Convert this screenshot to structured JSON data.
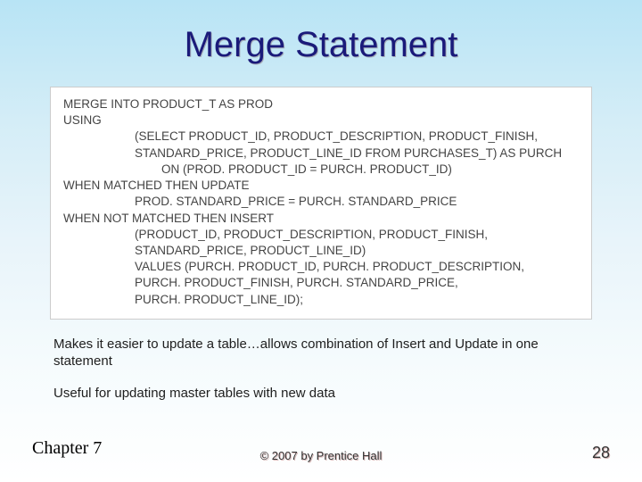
{
  "title": "Merge Statement",
  "code": {
    "line1": "MERGE INTO PRODUCT_T AS PROD",
    "line2": "USING",
    "line3": "(SELECT PRODUCT_ID, PRODUCT_DESCRIPTION, PRODUCT_FINISH,",
    "line4": "STANDARD_PRICE, PRODUCT_LINE_ID FROM PURCHASES_T) AS PURCH",
    "line5": "ON (PROD. PRODUCT_ID = PURCH. PRODUCT_ID)",
    "line6": "WHEN MATCHED THEN UPDATE",
    "line7": "PROD. STANDARD_PRICE = PURCH. STANDARD_PRICE",
    "line8": "WHEN NOT MATCHED THEN INSERT",
    "line9": "(PRODUCT_ID, PRODUCT_DESCRIPTION, PRODUCT_FINISH,",
    "line10": "STANDARD_PRICE, PRODUCT_LINE_ID)",
    "line11": "VALUES (PURCH. PRODUCT_ID, PURCH. PRODUCT_DESCRIPTION,",
    "line12": "PURCH. PRODUCT_FINISH, PURCH. STANDARD_PRICE,",
    "line13": "PURCH. PRODUCT_LINE_ID);"
  },
  "caption1": "Makes it easier to update a table…allows combination of Insert and Update in one statement",
  "caption2": "Useful for updating master tables with new data",
  "footer": {
    "left": "Chapter 7",
    "center": "© 2007 by Prentice Hall",
    "right": "28"
  }
}
